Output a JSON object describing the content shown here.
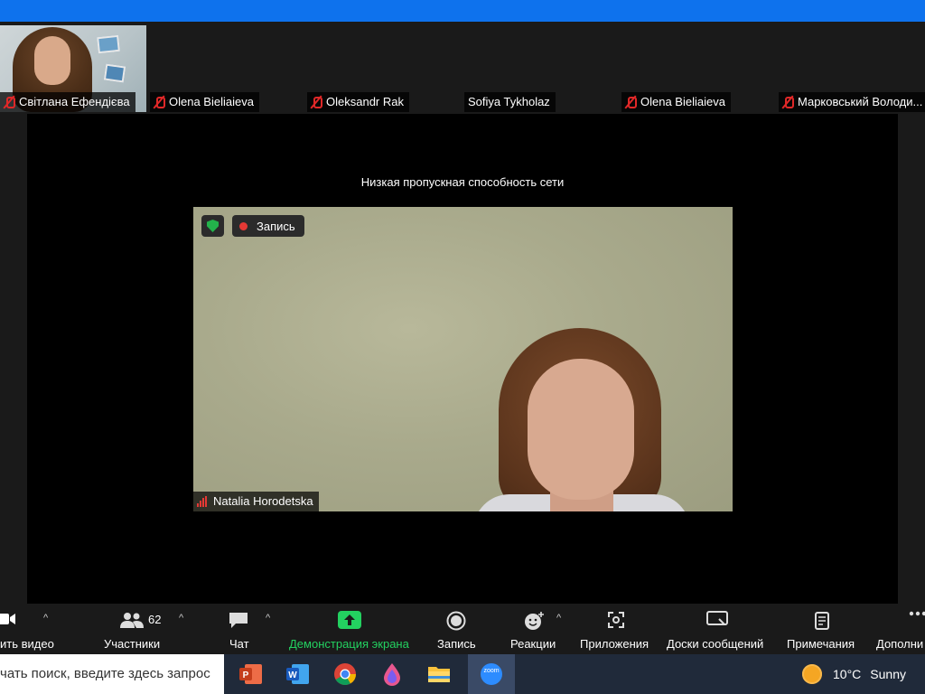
{
  "colors": {
    "titlebar": "#0e72ed",
    "accent_green": "#23d160",
    "muted_red": "#e02828",
    "recording_red": "#e53935",
    "stage": "#000000",
    "chrome": "#1a1a1a",
    "taskbar": "#202a3a"
  },
  "participants": [
    {
      "name": "Світлана Ефендієва",
      "muted": true,
      "has_video": true
    },
    {
      "name": "Olena Bieliaieva",
      "muted": true,
      "has_video": false
    },
    {
      "name": "Oleksandr Rak",
      "muted": true,
      "has_video": false
    },
    {
      "name": "Sofiya Tykholaz",
      "muted": false,
      "has_video": false
    },
    {
      "name": "Olena Bieliaieva",
      "muted": true,
      "has_video": false
    },
    {
      "name": "Марковський Володи...",
      "muted": true,
      "has_video": false
    }
  ],
  "stage": {
    "network_message": "Низкая пропускная способность сети",
    "recording_label": "Запись",
    "speaker_name": "Natalia Horodetska"
  },
  "toolbar": {
    "video_label": "ить видео",
    "participants_label": "Участники",
    "participants_count": "62",
    "chat_label": "Чат",
    "share_label": "Демонстрация экрана",
    "record_label": "Запись",
    "reactions_label": "Реакции",
    "apps_label": "Приложения",
    "whiteboards_label": "Доски сообщений",
    "notes_label": "Примечания",
    "more_label": "Дополни"
  },
  "taskbar": {
    "search_placeholder": "чать поиск, введите здесь запрос",
    "apps": [
      "powerpoint-icon",
      "word-icon",
      "chrome-icon",
      "paint-drop-icon",
      "file-explorer-icon",
      "zoom-icon"
    ],
    "zoom_label": "zoom",
    "weather_temp": "10°C",
    "weather_text": "Sunny"
  }
}
